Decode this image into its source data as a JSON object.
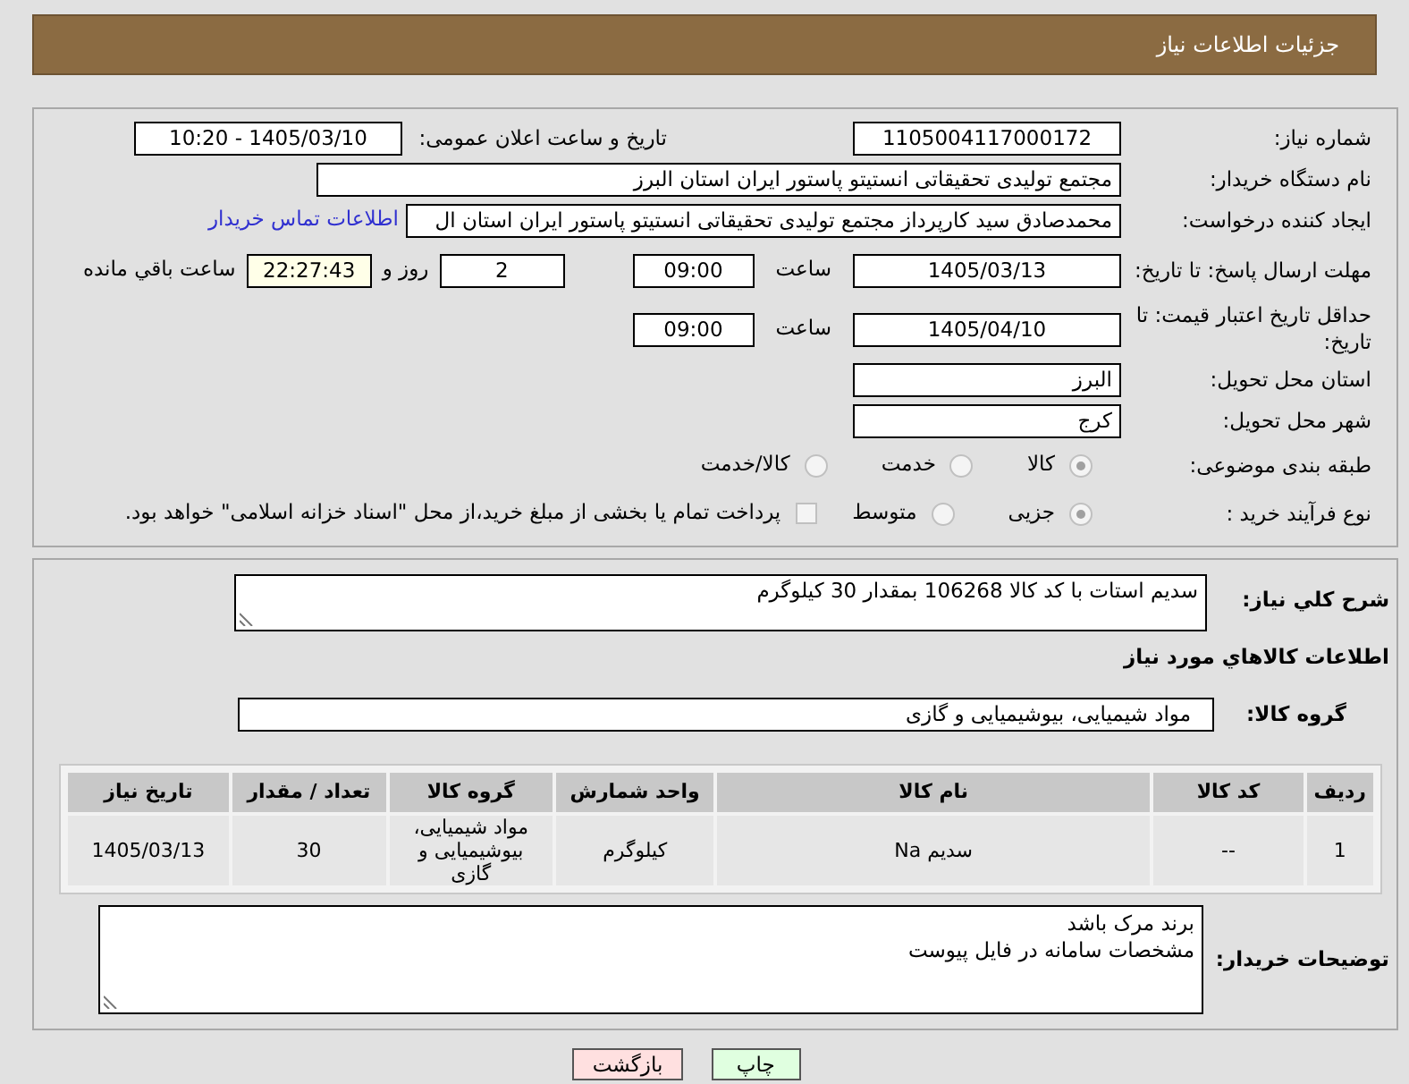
{
  "header": {
    "title": "جزئیات اطلاعات نیاز"
  },
  "need_number": {
    "label": "شماره نیاز:",
    "value": "1105004117000172"
  },
  "announce": {
    "label": "تاریخ و ساعت اعلان عمومی:",
    "value": "1405/03/10 - 10:20"
  },
  "buyer_org": {
    "label": "نام دستگاه خریدار:",
    "value": "مجتمع تولیدی تحقیقاتی انستیتو پاستور ایران استان البرز"
  },
  "creator": {
    "label": "ایجاد کننده درخواست:",
    "value": "محمدصادق سید کارپرداز مجتمع تولیدی تحقیقاتی انستیتو پاستور ایران استان ال",
    "link": "اطلاعات تماس خریدار"
  },
  "deadline": {
    "label": "مهلت ارسال پاسخ: تا تاریخ:",
    "date": "1405/03/13",
    "time_label": "ساعت",
    "time": "09:00",
    "days": "2",
    "days_label": "روز و",
    "remaining": "22:27:43",
    "remaining_label": "ساعت باقي مانده"
  },
  "validity": {
    "label": "حداقل تاریخ اعتبار قیمت: تا تاریخ:",
    "date": "1405/04/10",
    "time_label": "ساعت",
    "time": "09:00"
  },
  "province": {
    "label": "استان محل تحویل:",
    "value": "البرز"
  },
  "city": {
    "label": "شهر محل تحویل:",
    "value": "کرج"
  },
  "category": {
    "label": "طبقه بندی موضوعی:",
    "options": [
      {
        "label": "کالا",
        "selected": true
      },
      {
        "label": "خدمت",
        "selected": false
      },
      {
        "label": "کالا/خدمت",
        "selected": false
      }
    ]
  },
  "process": {
    "label": "نوع فرآیند خرید :",
    "options": [
      {
        "label": "جزیی",
        "selected": true
      },
      {
        "label": "متوسط",
        "selected": false
      }
    ],
    "treasury": {
      "label": "پرداخت تمام یا بخشی از مبلغ خرید،از محل \"اسناد خزانه اسلامی\" خواهد بود.",
      "checked": false
    }
  },
  "description": {
    "label": "شرح کلي نياز:",
    "value": "سدیم استات با کد کالا 106268 بمقدار 30 کیلوگرم"
  },
  "goods_heading": "اطلاعات کالاهاي مورد نياز",
  "goods_group": {
    "label": "گروه کالا:",
    "value": "مواد شیمیایی، بیوشیمیایی و  گازی"
  },
  "table": {
    "columns": [
      "رديف",
      "کد کالا",
      "نام کالا",
      "واحد شمارش",
      "گروه کالا",
      "تعداد / مقدار",
      "تاریخ نیاز"
    ],
    "rows": [
      {
        "cells": [
          "1",
          "--",
          "سدیم Na",
          "کیلوگرم",
          "مواد شیمیایی، بیوشیمیایی و گازی",
          "30",
          "1405/03/13"
        ]
      }
    ]
  },
  "buyer_notes": {
    "label": "توضیحات خریدار:",
    "lines": [
      "برند مرک باشد",
      "مشخصات سامانه در فایل پیوست"
    ]
  },
  "buttons": [
    {
      "label": "چاپ",
      "kind": "print"
    },
    {
      "label": "بازگشت",
      "kind": "back"
    }
  ]
}
